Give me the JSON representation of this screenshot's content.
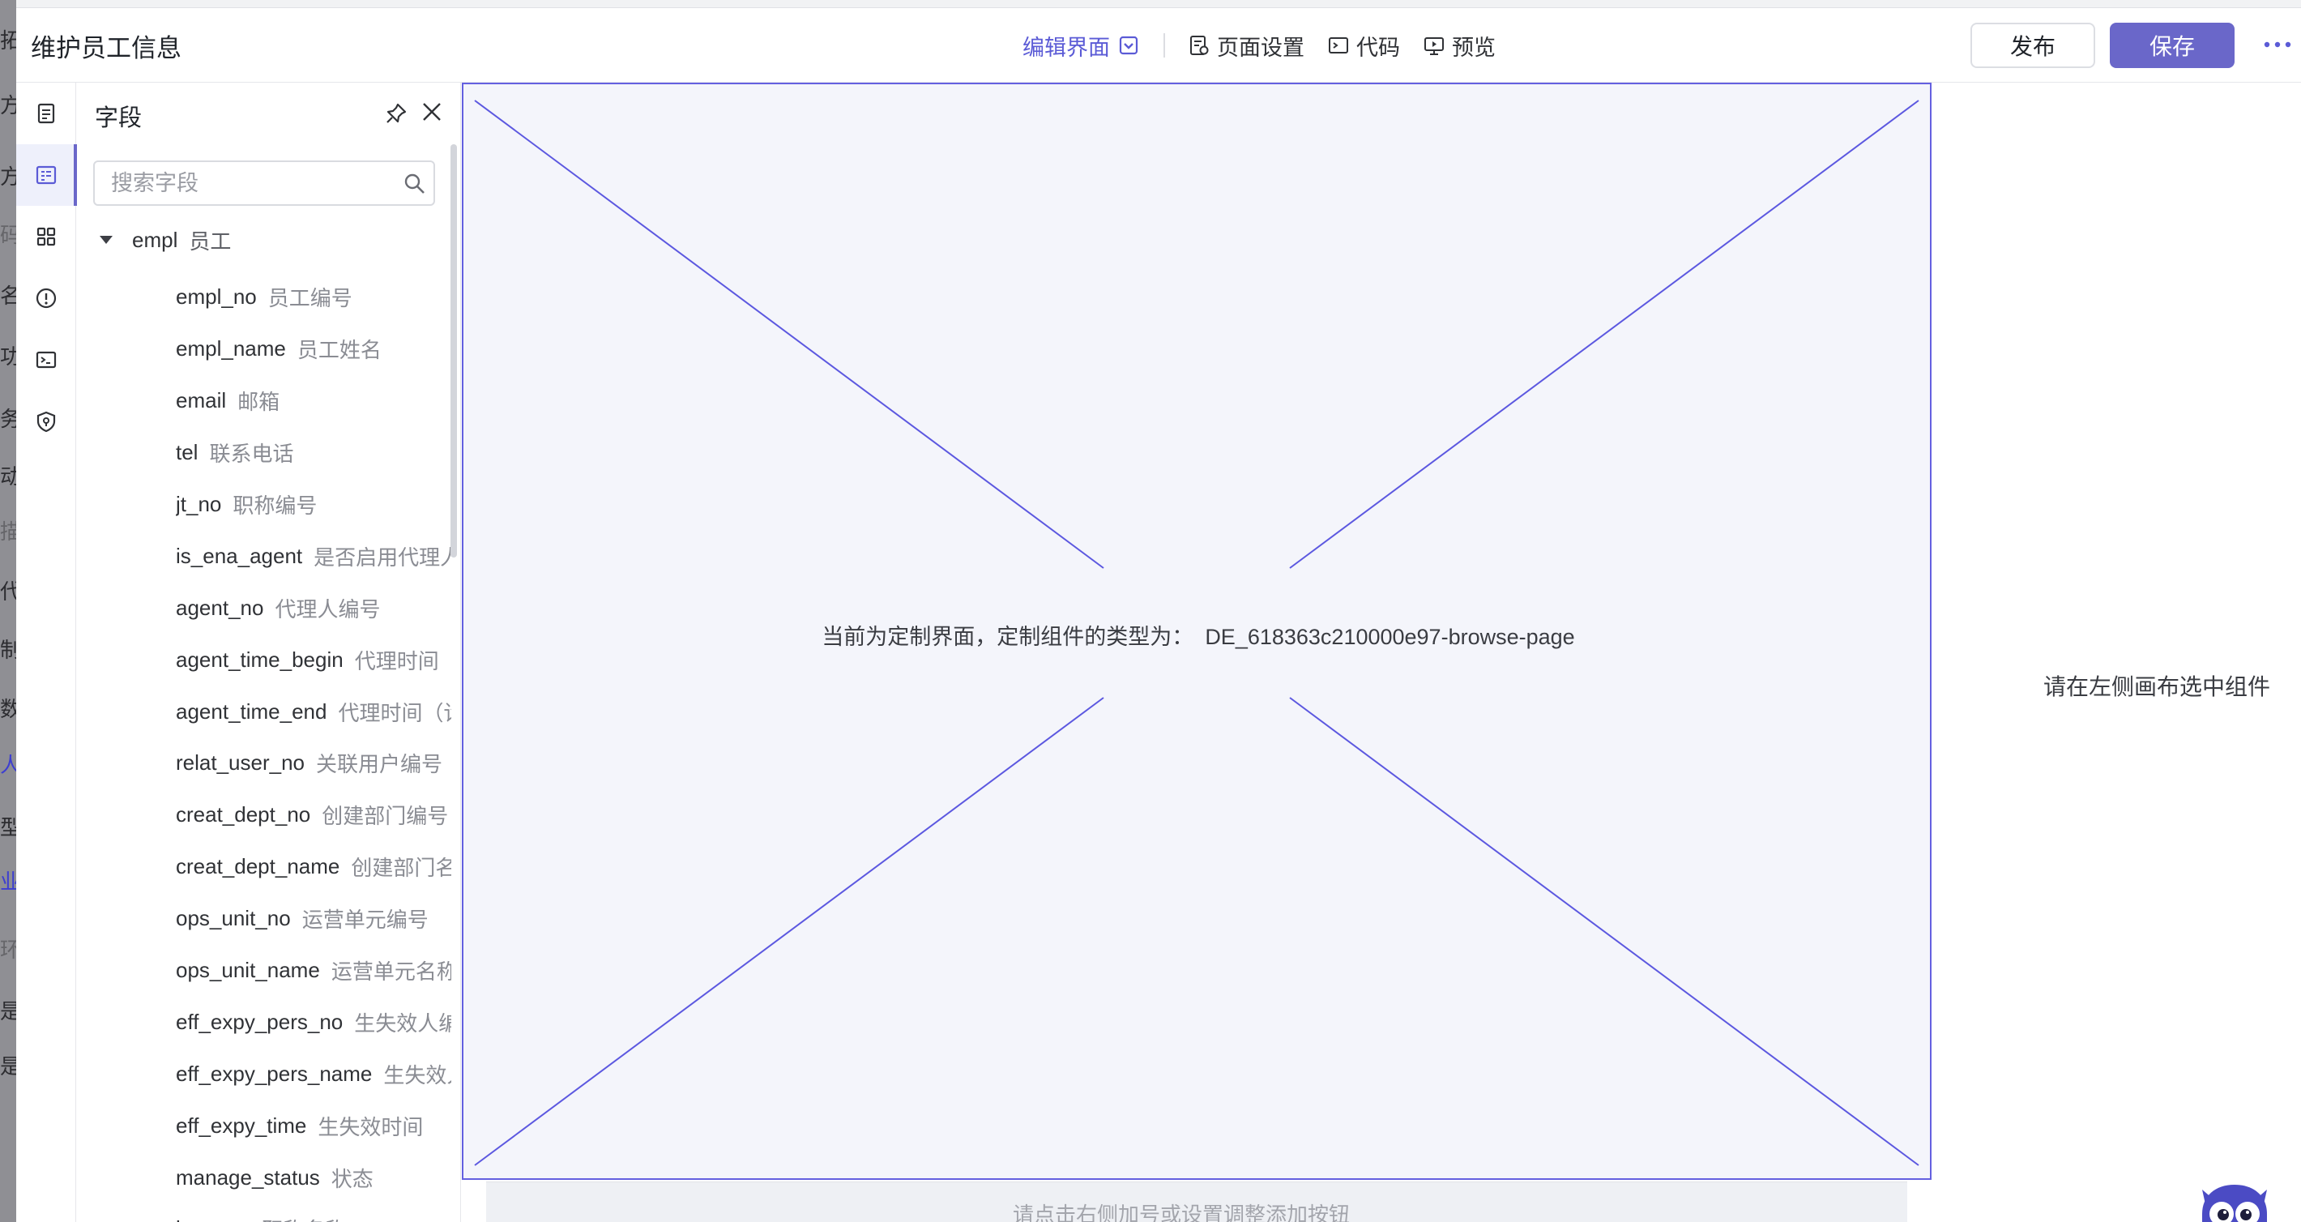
{
  "background_fragments": [
    {
      "text": "拓",
      "tone": "dark"
    },
    {
      "text": "方",
      "tone": "dark"
    },
    {
      "text": "方",
      "tone": "dark"
    },
    {
      "text": "码",
      "tone": "grey"
    },
    {
      "text": "名",
      "tone": "dark"
    },
    {
      "text": "功",
      "tone": "dark"
    },
    {
      "text": "务",
      "tone": "dark"
    },
    {
      "text": "动",
      "tone": "dark"
    },
    {
      "text": "描",
      "tone": "grey"
    },
    {
      "text": "代",
      "tone": "dark"
    },
    {
      "text": "制",
      "tone": "dark"
    },
    {
      "text": "数",
      "tone": "dark"
    },
    {
      "text": "人",
      "tone": "blue"
    },
    {
      "text": "型",
      "tone": "dark"
    },
    {
      "text": "业",
      "tone": "blue"
    },
    {
      "text": "环",
      "tone": "grey"
    },
    {
      "text": "是",
      "tone": "dark"
    },
    {
      "text": "是",
      "tone": "dark"
    }
  ],
  "header": {
    "title": "维护员工信息",
    "tabs": [
      {
        "label": "编辑界面",
        "icon": "chevron-down-icon",
        "active": true
      },
      {
        "label": "页面设置",
        "icon": "page-settings-icon"
      },
      {
        "label": "代码",
        "icon": "code-icon"
      },
      {
        "label": "预览",
        "icon": "preview-icon"
      }
    ],
    "publish_label": "发布",
    "save_label": "保存"
  },
  "rail": {
    "icons": [
      "outline-icon",
      "fields-icon",
      "components-icon",
      "alert-icon",
      "terminal-icon",
      "permission-icon"
    ],
    "active_index": 1
  },
  "field_panel": {
    "title": "字段",
    "search_placeholder": "搜索字段",
    "root": {
      "name": "empl",
      "label": "员工"
    },
    "fields": [
      {
        "name": "empl_no",
        "label": "员工编号"
      },
      {
        "name": "empl_name",
        "label": "员工姓名"
      },
      {
        "name": "email",
        "label": "邮箱"
      },
      {
        "name": "tel",
        "label": "联系电话"
      },
      {
        "name": "jt_no",
        "label": "职称编号"
      },
      {
        "name": "is_ena_agent",
        "label": "是否启用代理人"
      },
      {
        "name": "agent_no",
        "label": "代理人编号"
      },
      {
        "name": "agent_time_begin",
        "label": "代理时间"
      },
      {
        "name": "agent_time_end",
        "label": "代理时间（讫"
      },
      {
        "name": "relat_user_no",
        "label": "关联用户编号"
      },
      {
        "name": "creat_dept_no",
        "label": "创建部门编号"
      },
      {
        "name": "creat_dept_name",
        "label": "创建部门名"
      },
      {
        "name": "ops_unit_no",
        "label": "运营单元编号"
      },
      {
        "name": "ops_unit_name",
        "label": "运营单元名称"
      },
      {
        "name": "eff_expy_pers_no",
        "label": "生失效人编"
      },
      {
        "name": "eff_expy_pers_name",
        "label": "生失效人"
      },
      {
        "name": "eff_expy_time",
        "label": "生失效时间"
      },
      {
        "name": "manage_status",
        "label": "状态"
      },
      {
        "name": "jt_name",
        "label": "职称名称"
      }
    ]
  },
  "canvas": {
    "message_prefix": "当前为定制界面，定制组件的类型为：",
    "component_type": "DE_618363c210000e97-browse-page",
    "bottom_hint": "请点击右侧加号或设置调整添加按钮",
    "accent_color": "#6460e0"
  },
  "props_panel": {
    "empty_hint": "请在左侧画布选中组件"
  }
}
